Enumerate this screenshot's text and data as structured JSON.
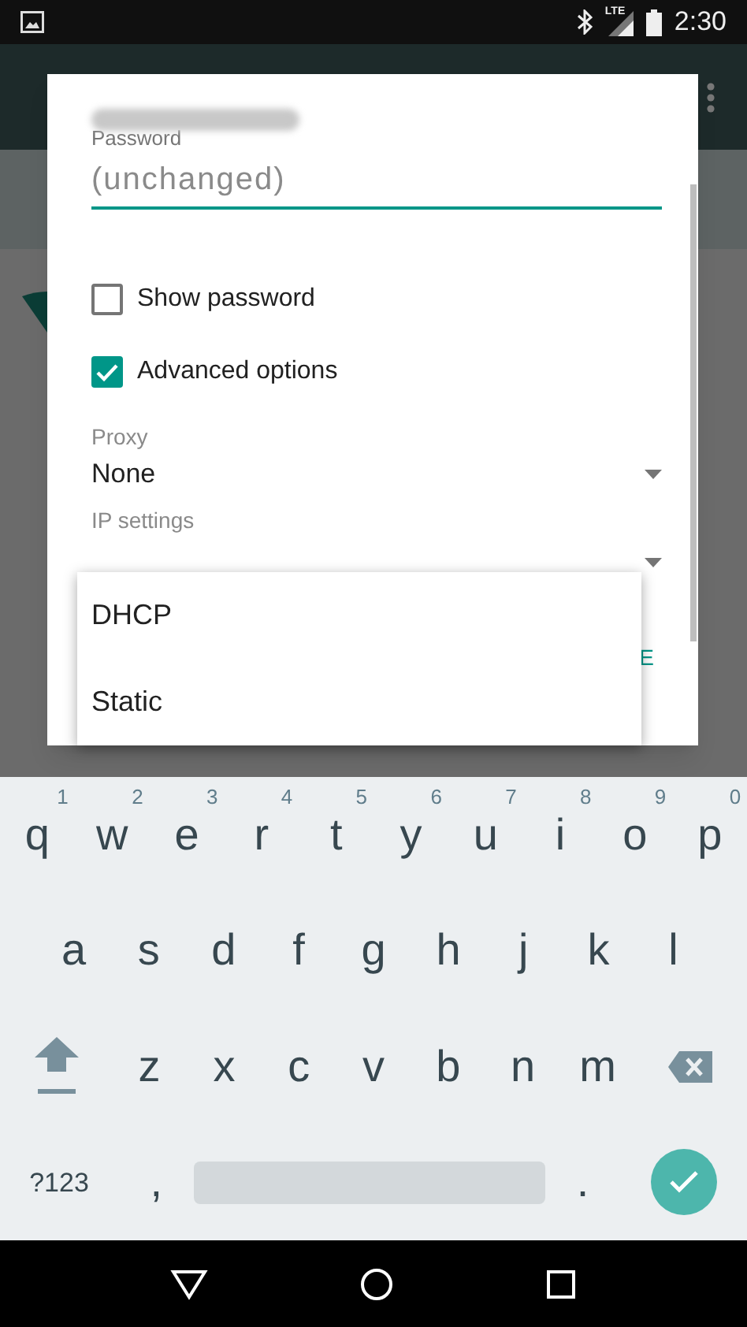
{
  "status_bar": {
    "time": "2:30",
    "network": "LTE"
  },
  "dialog": {
    "password": {
      "label": "Password",
      "placeholder": "(unchanged)"
    },
    "checkboxes": [
      {
        "label": "Show password",
        "checked": false
      },
      {
        "label": "Advanced options",
        "checked": true
      }
    ],
    "proxy": {
      "label": "Proxy",
      "value": "None"
    },
    "ip_settings": {
      "label": "IP settings"
    },
    "button_fragment": "E"
  },
  "dropdown": {
    "options": [
      "DHCP",
      "Static"
    ]
  },
  "keyboard": {
    "rows": [
      {
        "keys": [
          {
            "kind": "letter",
            "label": "q",
            "hint": "1"
          },
          {
            "kind": "letter",
            "label": "w",
            "hint": "2"
          },
          {
            "kind": "letter",
            "label": "e",
            "hint": "3"
          },
          {
            "kind": "letter",
            "label": "r",
            "hint": "4"
          },
          {
            "kind": "letter",
            "label": "t",
            "hint": "5"
          },
          {
            "kind": "letter",
            "label": "y",
            "hint": "6"
          },
          {
            "kind": "letter",
            "label": "u",
            "hint": "7"
          },
          {
            "kind": "letter",
            "label": "i",
            "hint": "8"
          },
          {
            "kind": "letter",
            "label": "o",
            "hint": "9"
          },
          {
            "kind": "letter",
            "label": "p",
            "hint": "0"
          }
        ]
      },
      {
        "keys": [
          {
            "kind": "letter",
            "label": "a"
          },
          {
            "kind": "letter",
            "label": "s"
          },
          {
            "kind": "letter",
            "label": "d"
          },
          {
            "kind": "letter",
            "label": "f"
          },
          {
            "kind": "letter",
            "label": "g"
          },
          {
            "kind": "letter",
            "label": "h"
          },
          {
            "kind": "letter",
            "label": "j"
          },
          {
            "kind": "letter",
            "label": "k"
          },
          {
            "kind": "letter",
            "label": "l"
          }
        ]
      },
      {
        "keys": [
          {
            "kind": "shift"
          },
          {
            "kind": "letter",
            "label": "z"
          },
          {
            "kind": "letter",
            "label": "x"
          },
          {
            "kind": "letter",
            "label": "c"
          },
          {
            "kind": "letter",
            "label": "v"
          },
          {
            "kind": "letter",
            "label": "b"
          },
          {
            "kind": "letter",
            "label": "n"
          },
          {
            "kind": "letter",
            "label": "m"
          },
          {
            "kind": "backspace"
          }
        ]
      },
      {
        "keys": [
          {
            "kind": "symbols",
            "label": "?123"
          },
          {
            "kind": "letter",
            "label": ","
          },
          {
            "kind": "space"
          },
          {
            "kind": "letter",
            "label": "."
          },
          {
            "kind": "enter"
          }
        ]
      }
    ]
  }
}
